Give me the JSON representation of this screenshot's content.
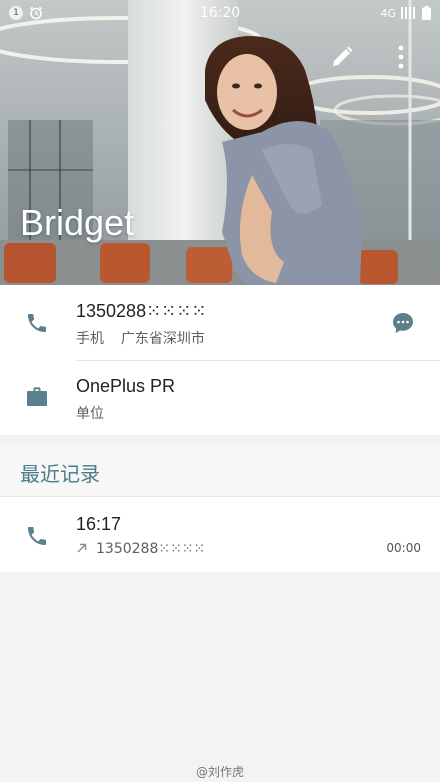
{
  "status_bar": {
    "notification_badge": "1",
    "time": "16:20",
    "network": "4G"
  },
  "header": {
    "contact_name": "Bridget"
  },
  "phone": {
    "number": "1350288⁙⁙⁙⁙",
    "label": "手机",
    "location": "广东省深圳市"
  },
  "company": {
    "name": "OnePlus PR",
    "label": "单位"
  },
  "recent": {
    "section_title": "最近记录",
    "call_time": "16:17",
    "call_number": "1350288⁙⁙⁙⁙",
    "duration": "00:00"
  },
  "watermark": "@刘作虎",
  "colors": {
    "accent": "#4d7a88",
    "icon": "#5c7f8c",
    "background": "#f3f3f3",
    "card": "#ffffff"
  },
  "icons": {
    "phone": "phone-icon",
    "message": "message-icon",
    "work": "briefcase-icon",
    "edit": "pencil-icon",
    "more": "more-vert-icon",
    "outgoing": "outgoing-arrow-icon"
  }
}
